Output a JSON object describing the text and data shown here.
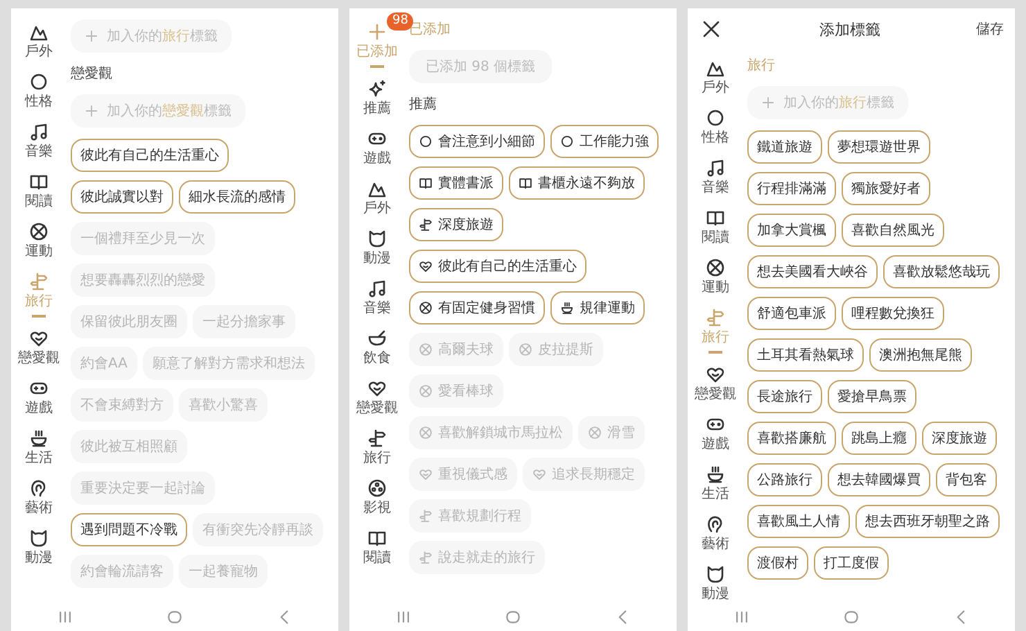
{
  "panels": [
    {
      "sidebar": [
        {
          "label": "戶外",
          "kind": "mountain",
          "selected": false
        },
        {
          "label": "性格",
          "kind": "circle",
          "selected": false
        },
        {
          "label": "音樂",
          "kind": "note",
          "selected": false
        },
        {
          "label": "閱讀",
          "kind": "book",
          "selected": false
        },
        {
          "label": "運動",
          "kind": "ball",
          "selected": false
        },
        {
          "label": "旅行",
          "kind": "signpost",
          "selected": true
        },
        {
          "label": "戀愛觀",
          "kind": "heart",
          "selected": false
        },
        {
          "label": "遊戲",
          "kind": "gamepad",
          "selected": false
        },
        {
          "label": "生活",
          "kind": "cup",
          "selected": false
        },
        {
          "label": "藝術",
          "kind": "ear",
          "selected": false
        },
        {
          "label": "動漫",
          "kind": "cat",
          "selected": false
        }
      ],
      "content": [
        {
          "kind": "add",
          "before": "加入你的",
          "keyword": "旅行",
          "after": "標籤"
        },
        {
          "kind": "heading",
          "text": "戀愛觀",
          "active": false
        },
        {
          "kind": "add",
          "before": "加入你的",
          "keyword": "戀愛觀",
          "after": "標籤"
        },
        {
          "kind": "tags",
          "items": [
            {
              "label": "彼此有自己的生活重心",
              "selected": true
            },
            {
              "label": "彼此誠實以對",
              "selected": true
            },
            {
              "label": "細水長流的感情",
              "selected": true
            },
            {
              "label": "一個禮拜至少見一次",
              "selected": false
            },
            {
              "label": "想要轟轟烈烈的戀愛",
              "selected": false
            },
            {
              "label": "保留彼此朋友圈",
              "selected": false
            },
            {
              "label": "一起分擔家事",
              "selected": false
            },
            {
              "label": "約會AA",
              "selected": false
            },
            {
              "label": "願意了解對方需求和想法",
              "selected": false
            },
            {
              "label": "不會束縛對方",
              "selected": false
            },
            {
              "label": "喜歡小驚喜",
              "selected": false
            },
            {
              "label": "彼此被互相照顧",
              "selected": false
            },
            {
              "label": "重要決定要一起討論",
              "selected": false
            },
            {
              "label": "遇到問題不冷戰",
              "selected": true
            },
            {
              "label": "有衝突先冷靜再談",
              "selected": false
            },
            {
              "label": "約會輪流請客",
              "selected": false
            },
            {
              "label": "一起養寵物",
              "selected": false
            }
          ]
        }
      ]
    },
    {
      "sidebar": [
        {
          "label": "已添加",
          "kind": "plus",
          "selected": true,
          "badge": "98"
        },
        {
          "label": "推薦",
          "kind": "sparkle",
          "selected": false
        },
        {
          "label": "遊戲",
          "kind": "gamepad",
          "selected": false
        },
        {
          "label": "戶外",
          "kind": "mountain",
          "selected": false
        },
        {
          "label": "動漫",
          "kind": "cat",
          "selected": false
        },
        {
          "label": "音樂",
          "kind": "note",
          "selected": false
        },
        {
          "label": "飲食",
          "kind": "bowl",
          "selected": false
        },
        {
          "label": "戀愛觀",
          "kind": "heart",
          "selected": false
        },
        {
          "label": "旅行",
          "kind": "signpost",
          "selected": false
        },
        {
          "label": "影視",
          "kind": "reel",
          "selected": false
        },
        {
          "label": "閱讀",
          "kind": "book",
          "selected": false
        }
      ],
      "content": [
        {
          "kind": "heading",
          "text": "已添加",
          "active": true
        },
        {
          "kind": "field",
          "value": "已添加 98 個標籤"
        },
        {
          "kind": "heading",
          "text": "推薦",
          "active": false
        },
        {
          "kind": "tags",
          "items": [
            {
              "label": "會注意到小細節",
              "kind": "circle",
              "selected": true
            },
            {
              "label": "工作能力強",
              "kind": "circle",
              "selected": true
            },
            {
              "label": "實體書派",
              "kind": "book",
              "selected": true
            },
            {
              "label": "書櫃永遠不夠放",
              "kind": "book",
              "selected": true
            },
            {
              "label": "深度旅遊",
              "kind": "signpost",
              "selected": true
            },
            {
              "label": "彼此有自己的生活重心",
              "kind": "heart",
              "selected": true
            },
            {
              "label": "有固定健身習慣",
              "kind": "ball",
              "selected": true
            },
            {
              "label": "規律運動",
              "kind": "cup",
              "selected": true
            },
            {
              "label": "高爾夫球",
              "kind": "ball",
              "selected": false
            },
            {
              "label": "皮拉提斯",
              "kind": "ball",
              "selected": false
            },
            {
              "label": "愛看棒球",
              "kind": "ball",
              "selected": false
            },
            {
              "label": "喜歡解鎖城市馬拉松",
              "kind": "ball",
              "selected": false
            },
            {
              "label": "滑雪",
              "kind": "ball",
              "selected": false
            },
            {
              "label": "重視儀式感",
              "kind": "heart",
              "selected": false
            },
            {
              "label": "追求長期穩定",
              "kind": "heart",
              "selected": false
            },
            {
              "label": "喜歡規劃行程",
              "kind": "signpost",
              "selected": false
            },
            {
              "label": "說走就走的旅行",
              "kind": "signpost",
              "selected": false
            }
          ]
        }
      ]
    },
    {
      "header": {
        "title": "添加標籤",
        "save": "儲存"
      },
      "sidebar": [
        {
          "label": "戶外",
          "kind": "mountain",
          "selected": false
        },
        {
          "label": "性格",
          "kind": "circle",
          "selected": false
        },
        {
          "label": "音樂",
          "kind": "note",
          "selected": false
        },
        {
          "label": "閱讀",
          "kind": "book",
          "selected": false
        },
        {
          "label": "運動",
          "kind": "ball",
          "selected": false
        },
        {
          "label": "旅行",
          "kind": "signpost",
          "selected": true
        },
        {
          "label": "戀愛觀",
          "kind": "heart",
          "selected": false
        },
        {
          "label": "遊戲",
          "kind": "gamepad",
          "selected": false
        },
        {
          "label": "生活",
          "kind": "cup",
          "selected": false
        },
        {
          "label": "藝術",
          "kind": "ear",
          "selected": false
        },
        {
          "label": "動漫",
          "kind": "cat",
          "selected": false
        }
      ],
      "content": [
        {
          "kind": "heading",
          "text": "旅行",
          "active": true
        },
        {
          "kind": "add",
          "before": "加入你的",
          "keyword": "旅行",
          "after": "標籤"
        },
        {
          "kind": "tags",
          "items": [
            {
              "label": "鐵道旅遊",
              "selected": true
            },
            {
              "label": "夢想環遊世界",
              "selected": true
            },
            {
              "label": "行程排滿滿",
              "selected": true
            },
            {
              "label": "獨旅愛好者",
              "selected": true
            },
            {
              "label": "加拿大賞楓",
              "selected": true
            },
            {
              "label": "喜歡自然風光",
              "selected": true
            },
            {
              "label": "想去美國看大峽谷",
              "selected": true
            },
            {
              "label": "喜歡放鬆悠哉玩",
              "selected": true
            },
            {
              "label": "舒適包車派",
              "selected": true
            },
            {
              "label": "哩程數兌換狂",
              "selected": true
            },
            {
              "label": "土耳其看熱氣球",
              "selected": true
            },
            {
              "label": "澳洲抱無尾熊",
              "selected": true
            },
            {
              "label": "長途旅行",
              "selected": true
            },
            {
              "label": "愛搶早鳥票",
              "selected": true
            },
            {
              "label": "喜歡搭廉航",
              "selected": true
            },
            {
              "label": "跳島上癮",
              "selected": true
            },
            {
              "label": "深度旅遊",
              "selected": true
            },
            {
              "label": "公路旅行",
              "selected": true
            },
            {
              "label": "想去韓國爆買",
              "selected": true
            },
            {
              "label": "背包客",
              "selected": true
            },
            {
              "label": "喜歡風土人情",
              "selected": true
            },
            {
              "label": "想去西班牙朝聖之路",
              "selected": true
            },
            {
              "label": "渡假村",
              "selected": true
            },
            {
              "label": "打工度假",
              "selected": true
            }
          ]
        }
      ]
    }
  ]
}
